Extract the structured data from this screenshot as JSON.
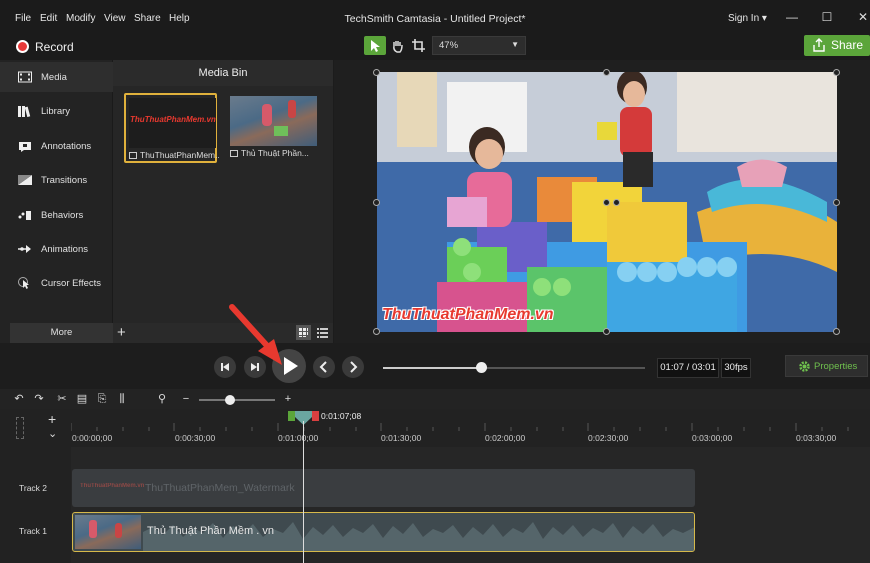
{
  "titlebar": {
    "menu": [
      "File",
      "Edit",
      "Modify",
      "View",
      "Share",
      "Help"
    ],
    "title": "TechSmith Camtasia - Untitled Project*",
    "signin": "Sign In ▾"
  },
  "toolbar": {
    "record_label": "Record",
    "zoom_value": "47%",
    "share_label": "Share",
    "colors": {
      "record": "#e83a3a",
      "share": "#5ba53a"
    }
  },
  "sidebar": {
    "items": [
      {
        "label": "Media",
        "icon": "film-icon"
      },
      {
        "label": "Library",
        "icon": "library-icon"
      },
      {
        "label": "Annotations",
        "icon": "annotation-icon"
      },
      {
        "label": "Transitions",
        "icon": "transition-icon"
      },
      {
        "label": "Behaviors",
        "icon": "behavior-icon"
      },
      {
        "label": "Animations",
        "icon": "animation-icon"
      },
      {
        "label": "Cursor Effects",
        "icon": "cursor-icon"
      }
    ],
    "more_label": "More"
  },
  "media_bin": {
    "title": "Media Bin",
    "items": [
      {
        "caption": "ThuThuatPhanMem...",
        "thumb_text": "ThuThuatPhanMem.vn"
      },
      {
        "caption": "Thủ Thuật Phần..."
      }
    ]
  },
  "canvas": {
    "watermark": "ThuThuatPhanMem.vn"
  },
  "playback": {
    "time": "01:07 / 03:01",
    "fps": "30fps",
    "properties_label": "Properties",
    "progress_fraction": 0.37
  },
  "timeline": {
    "playhead_time": "0:01:07;08",
    "ticks": [
      "0:00:00;00",
      "0:00:30;00",
      "0:01:00;00",
      "0:01:30;00",
      "0:02:00;00",
      "0:02:30;00",
      "0:03:00;00",
      "0:03:30;00"
    ],
    "tracks": [
      {
        "label": "Track 2",
        "clip": "ThuThuatPhanMem_Watermark",
        "clip_logo": "ThuThuatPhanMem.vn"
      },
      {
        "label": "Track 1",
        "clip": "Thủ Thuật Phần Mềm . vn"
      }
    ]
  }
}
